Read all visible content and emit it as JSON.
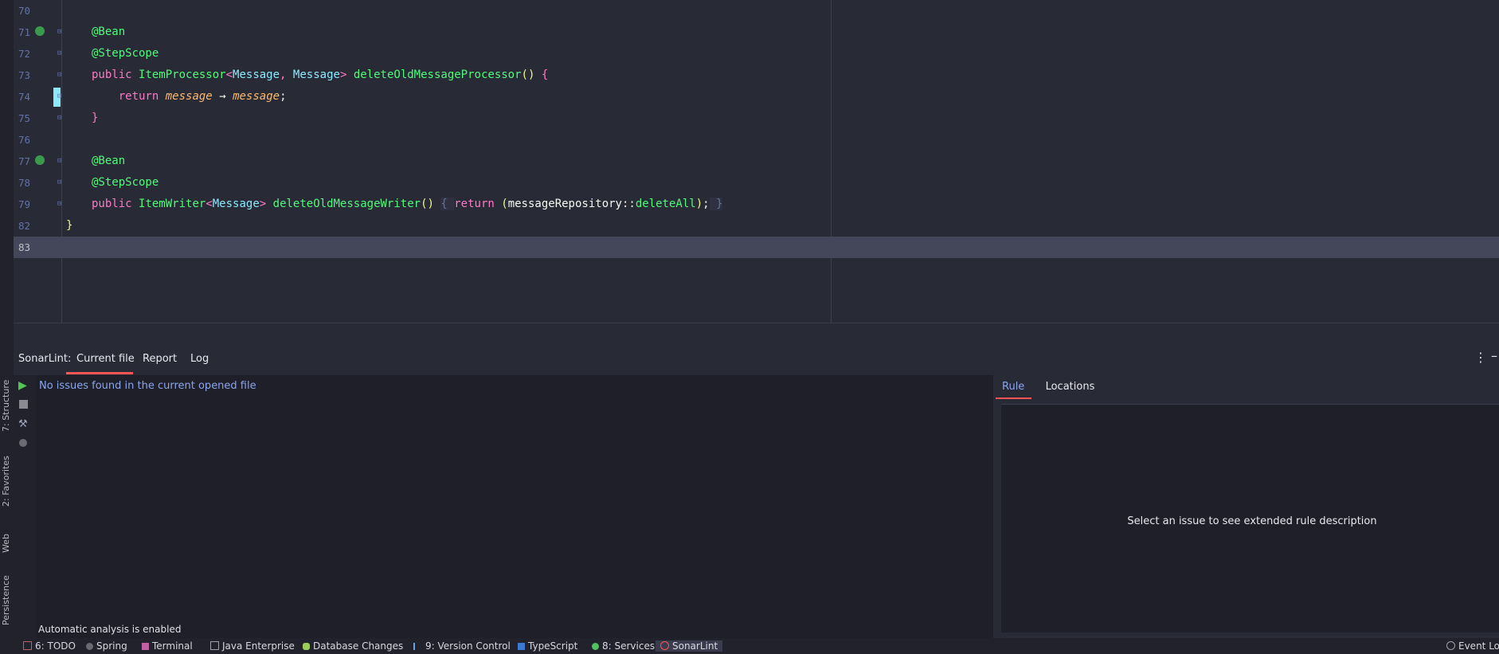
{
  "editor": {
    "lines": [
      {
        "num": "70",
        "html": ""
      },
      {
        "num": "71",
        "html": "<span class='ann'>@Bean</span>"
      },
      {
        "num": "72",
        "html": "<span class='ann'>@StepScope</span>"
      },
      {
        "num": "73",
        "html": "<span class='kw'>public</span> <span class='fn'>ItemProcessor</span><span class='kw'>&lt;</span><span class='type'>Message</span><span class='kw'>,</span> <span class='type'>Message</span><span class='kw'>&gt;</span> <span class='fn'>deleteOldMessageProcessor</span><span class='paren'>()</span> <span class='kw'>{</span>"
      },
      {
        "num": "74",
        "html": "    <span class='kw'>return</span> <span class='ital'>message</span> <span class='plain'>→</span> <span class='ital'>message</span><span class='plain'>;</span>"
      },
      {
        "num": "75",
        "html": "<span class='kw'>}</span>"
      },
      {
        "num": "76",
        "html": ""
      },
      {
        "num": "77",
        "html": "<span class='ann'>@Bean</span>"
      },
      {
        "num": "78",
        "html": "<span class='ann'>@StepScope</span>"
      },
      {
        "num": "79",
        "html": "<span class='kw'>public</span> <span class='fn'>ItemWriter</span><span class='kw'>&lt;</span><span class='type'>Message</span><span class='kw'>&gt;</span> <span class='fn'>deleteOldMessageWriter</span><span class='paren'>()</span> <span class='fold-inline'>{ </span><span class='kw'>return</span> <span class='paren'>(</span><span class='plain'>messageRepository::</span><span class='fn'>deleteAll</span><span class='paren'>)</span><span class='plain'>;</span><span class='fold-inline'> }</span>"
      },
      {
        "num": "82",
        "html": "<span class='paren'>}</span>"
      },
      {
        "num": "83",
        "html": ""
      }
    ]
  },
  "sonarlint": {
    "label": "SonarLint:",
    "tabs": [
      "Current file",
      "Report",
      "Log"
    ],
    "active_tab": "Current file",
    "issues_message": "No issues found in the current opened file",
    "analysis_status": "Automatic analysis is enabled",
    "rule_tabs": [
      "Rule",
      "Locations"
    ],
    "rule_message": "Select an issue to see extended rule description"
  },
  "left_tools": [
    "7: Structure",
    "2: Favorites",
    "Web",
    "Persistence"
  ],
  "bottom_tools": [
    "6: TODO",
    "Spring",
    "Terminal",
    "Java Enterprise",
    "Database Changes",
    "9: Version Control",
    "TypeScript",
    "8: Services",
    "SonarLint"
  ],
  "event_log": "Event Log",
  "colors": {
    "accent": "#ff5555",
    "background": "#282a36",
    "panel": "#1e1f29"
  }
}
